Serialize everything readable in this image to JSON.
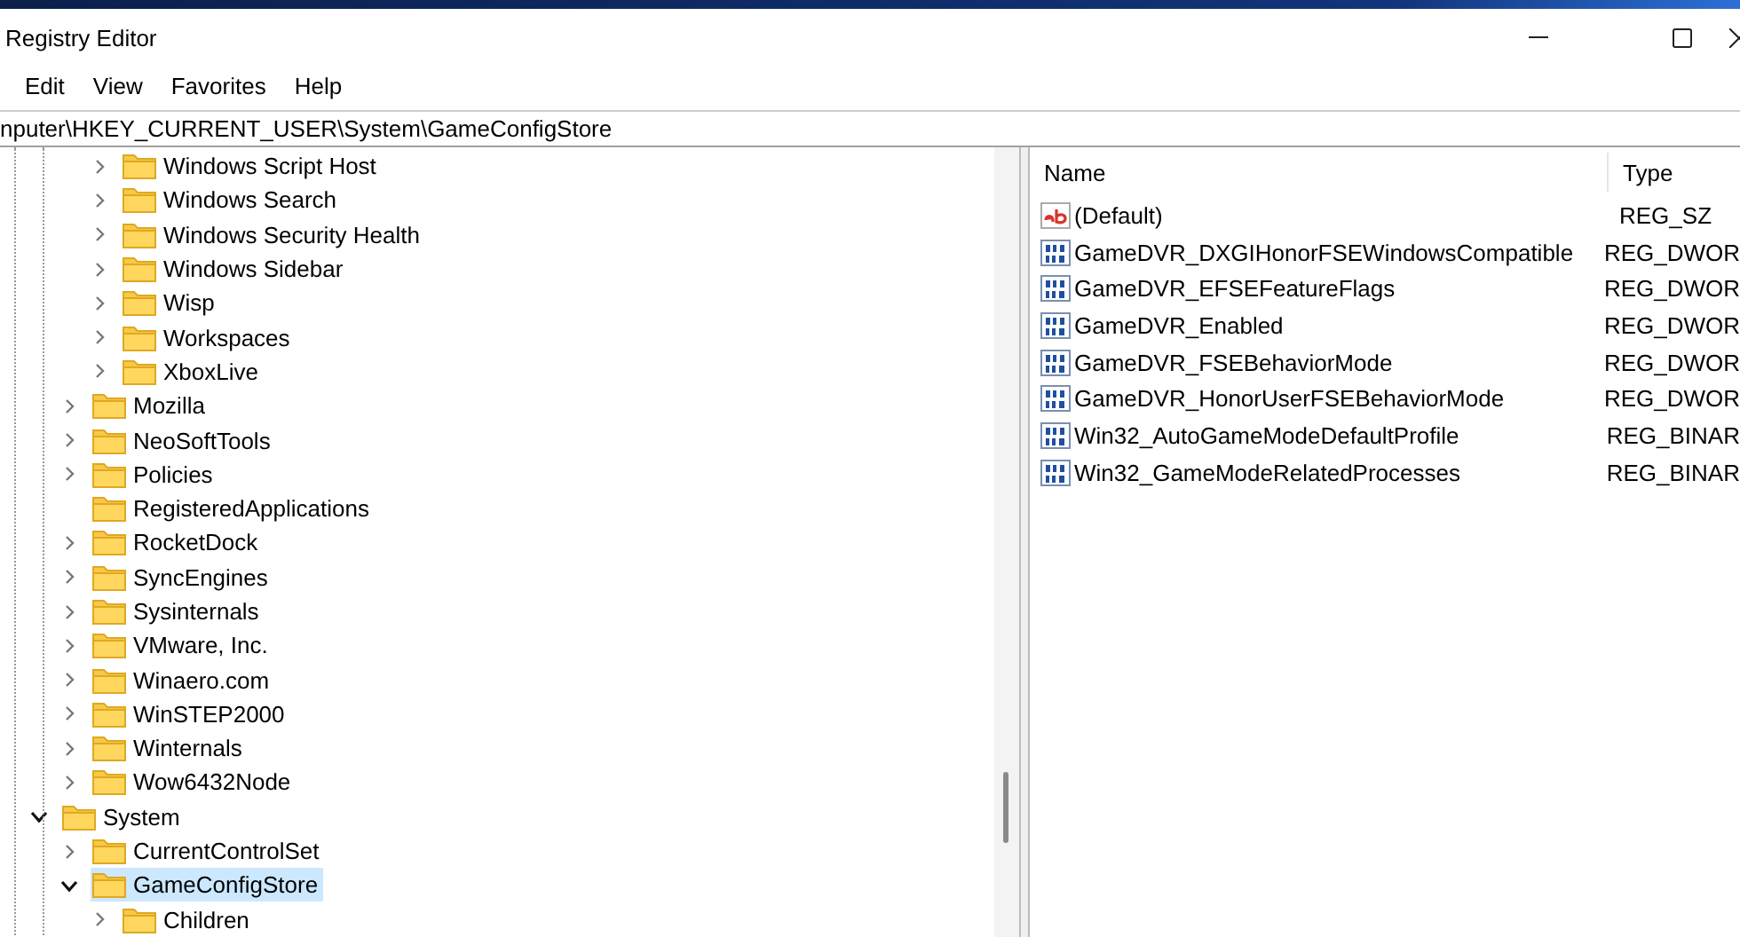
{
  "window": {
    "title": "Registry Editor"
  },
  "menu": [
    "Edit",
    "View",
    "Favorites",
    "Help"
  ],
  "address": "nputer\\HKEY_CURRENT_USER\\System\\GameConfigStore",
  "tree": [
    {
      "children": [
        {
          "children": [
            {
              "label": "Windows Script Host",
              "expanded": false,
              "expandable": true,
              "selected": false
            },
            {
              "label": "Windows Search",
              "expanded": false,
              "expandable": true,
              "selected": false
            },
            {
              "label": "Windows Security Health",
              "expanded": false,
              "expandable": true,
              "selected": false
            },
            {
              "label": "Windows Sidebar",
              "expanded": false,
              "expandable": true,
              "selected": false
            },
            {
              "label": "Wisp",
              "expanded": false,
              "expandable": true,
              "selected": false
            },
            {
              "label": "Workspaces",
              "expanded": false,
              "expandable": true,
              "selected": false
            },
            {
              "label": "XboxLive",
              "expanded": false,
              "expandable": true,
              "selected": false
            }
          ]
        },
        {
          "label": "Mozilla",
          "expanded": false,
          "expandable": true,
          "selected": false
        },
        {
          "label": "NeoSoftTools",
          "expanded": false,
          "expandable": true,
          "selected": false
        },
        {
          "label": "Policies",
          "expanded": false,
          "expandable": true,
          "selected": false
        },
        {
          "label": "RegisteredApplications",
          "expandable": false,
          "selected": false
        },
        {
          "label": "RocketDock",
          "expanded": false,
          "expandable": true,
          "selected": false
        },
        {
          "label": "SyncEngines",
          "expanded": false,
          "expandable": true,
          "selected": false
        },
        {
          "label": "Sysinternals",
          "expanded": false,
          "expandable": true,
          "selected": false
        },
        {
          "label": "VMware, Inc.",
          "expanded": false,
          "expandable": true,
          "selected": false
        },
        {
          "label": "Winaero.com",
          "expanded": false,
          "expandable": true,
          "selected": false
        },
        {
          "label": "WinSTEP2000",
          "expanded": false,
          "expandable": true,
          "selected": false
        },
        {
          "label": "Winternals",
          "expanded": false,
          "expandable": true,
          "selected": false
        },
        {
          "label": "Wow6432Node",
          "expanded": false,
          "expandable": true,
          "selected": false
        }
      ]
    },
    {
      "label": "System",
      "expanded": true,
      "expandable": true,
      "selected": false,
      "children": [
        {
          "label": "CurrentControlSet",
          "expanded": false,
          "expandable": true,
          "selected": false
        },
        {
          "label": "GameConfigStore",
          "expanded": true,
          "expandable": true,
          "selected": true,
          "children": [
            {
              "label": "Children",
              "expanded": false,
              "expandable": true,
              "selected": false
            }
          ]
        }
      ]
    }
  ],
  "values": {
    "columns": [
      "Name",
      "Type"
    ],
    "rows": [
      {
        "name": "(Default)",
        "type": "REG_SZ",
        "kind": "string"
      },
      {
        "name": "GameDVR_DXGIHonorFSEWindowsCompatible",
        "type": "REG_DWOR",
        "kind": "binary"
      },
      {
        "name": "GameDVR_EFSEFeatureFlags",
        "type": "REG_DWOR",
        "kind": "binary"
      },
      {
        "name": "GameDVR_Enabled",
        "type": "REG_DWOR",
        "kind": "binary"
      },
      {
        "name": "GameDVR_FSEBehaviorMode",
        "type": "REG_DWOR",
        "kind": "binary"
      },
      {
        "name": "GameDVR_HonorUserFSEBehaviorMode",
        "type": "REG_DWOR",
        "kind": "binary"
      },
      {
        "name": "Win32_AutoGameModeDefaultProfile",
        "type": "REG_BINAR",
        "kind": "binary"
      },
      {
        "name": "Win32_GameModeRelatedProcesses",
        "type": "REG_BINAR",
        "kind": "binary"
      }
    ]
  }
}
